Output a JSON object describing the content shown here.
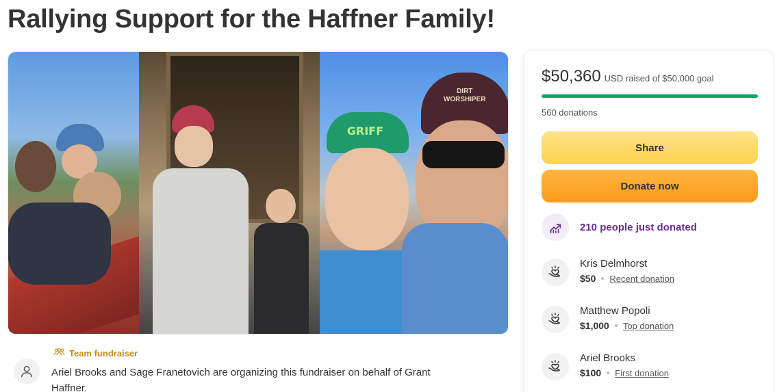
{
  "page": {
    "title": "Rallying Support for the Haffner Family!"
  },
  "hero": {
    "cap_text": "DIRT WORSHIPER",
    "hat_text": "GRIFF"
  },
  "organizer": {
    "badge_label": "Team fundraiser",
    "text": "Ariel Brooks and Sage Franetovich are organizing this fundraiser on behalf of Grant Haffner."
  },
  "card": {
    "raised": "$50,360",
    "raised_meta": "USD raised of $50,000 goal",
    "progress": 1.0,
    "donations": "560 donations",
    "share_label": "Share",
    "donate_label": "Donate now",
    "trend_text": "210 people just donated",
    "donors": [
      {
        "name": "Kris Delmhorst",
        "amount": "$50",
        "kind": "Recent donation"
      },
      {
        "name": "Matthew Popoli",
        "amount": "$1,000",
        "kind": "Top donation"
      },
      {
        "name": "Ariel Brooks",
        "amount": "$100",
        "kind": "First donation"
      }
    ]
  },
  "colors": {
    "progress": "#02a95c",
    "share_button": "#fcd34d",
    "donate_button": "#fb9b1b",
    "trend_text": "#6b2c91",
    "team_badge": "#c28a12"
  },
  "icons": {
    "organizer_avatar": "user-icon",
    "team_badge": "team-icon",
    "trend": "trending-up-icon",
    "donor": "heart-hand-icon"
  }
}
